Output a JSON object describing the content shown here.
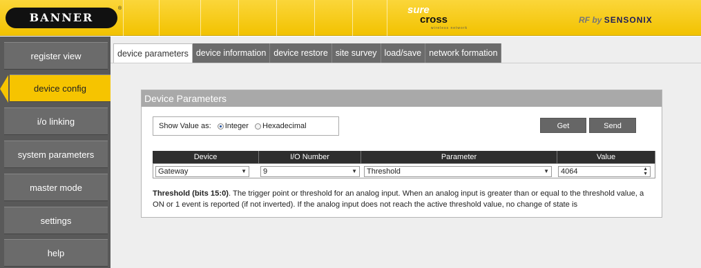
{
  "header": {
    "logo": "BANNER",
    "logo_mark": "®",
    "product_top": "sure",
    "product_main": "cross",
    "product_tag": "wireless network",
    "rf_prefix": "RF by",
    "rf_brand": "SENSONIX"
  },
  "sidebar": {
    "items": [
      {
        "label": "register view",
        "active": false
      },
      {
        "label": "device config",
        "active": true
      },
      {
        "label": "i/o linking",
        "active": false
      },
      {
        "label": "system parameters",
        "active": false
      },
      {
        "label": "master mode",
        "active": false
      },
      {
        "label": "settings",
        "active": false
      },
      {
        "label": "help",
        "active": false
      }
    ]
  },
  "tabs": [
    {
      "label": "device parameters",
      "active": true
    },
    {
      "label": "device information",
      "active": false
    },
    {
      "label": "device restore",
      "active": false
    },
    {
      "label": "site survey",
      "active": false
    },
    {
      "label": "load/save",
      "active": false
    },
    {
      "label": "network formation",
      "active": false
    }
  ],
  "panel": {
    "title": "Device Parameters",
    "show_value_label": "Show Value as:",
    "options": [
      {
        "label": "Integer",
        "selected": true
      },
      {
        "label": "Hexadecimal",
        "selected": false
      }
    ],
    "get_label": "Get",
    "send_label": "Send",
    "columns": [
      "Device",
      "I/O Number",
      "Parameter",
      "Value"
    ],
    "row": {
      "device": "Gateway",
      "io_number": "9",
      "parameter": "Threshold",
      "value": "4064"
    },
    "desc_bold": "Threshold (bits 15:0)",
    "desc_text": ". The trigger point or threshold for an analog input. When an analog input is greater than or equal to the threshold value, a ON or 1 event is reported (if not inverted). If the analog input does not reach the active threshold value, no change of state is"
  },
  "colors": {
    "header_yellow": "#f2c200",
    "sidebar_gray": "#595959",
    "active_yellow": "#f6c400"
  }
}
